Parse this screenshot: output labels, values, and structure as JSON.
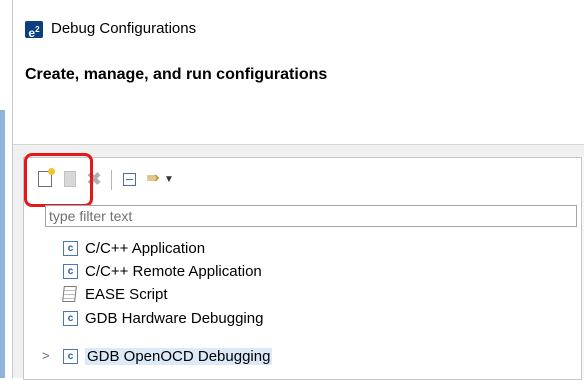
{
  "window": {
    "app_icon_text": "e²",
    "title": "Debug Configurations",
    "heading": "Create, manage, and run configurations"
  },
  "toolbar": {
    "buttons": [
      {
        "icon": "new-launch-configuration-icon",
        "enabled": true
      },
      {
        "icon": "duplicate-icon",
        "enabled": false
      },
      {
        "icon": "delete-icon",
        "enabled": false
      },
      {
        "icon": "collapse-all-icon",
        "enabled": true
      },
      {
        "icon": "filter-icon",
        "enabled": true
      },
      {
        "icon": "dropdown-arrow-icon",
        "enabled": true
      }
    ],
    "highlight_color": "#e31818"
  },
  "filter": {
    "placeholder": "type filter text",
    "value": ""
  },
  "tree": {
    "items": [
      {
        "label": "C/C++ Application",
        "icon": "c-launch-icon"
      },
      {
        "label": "C/C++ Remote Application",
        "icon": "c-launch-icon"
      },
      {
        "label": "EASE Script",
        "icon": "script-icon"
      },
      {
        "label": "GDB Hardware Debugging",
        "icon": "c-launch-icon"
      },
      {
        "label": "GDB OpenOCD Debugging",
        "icon": "c-launch-icon",
        "selected": true,
        "expandable": true
      }
    ]
  },
  "colors": {
    "selection": "#dce9f7",
    "app_icon_bg": "#0b3f7d"
  }
}
